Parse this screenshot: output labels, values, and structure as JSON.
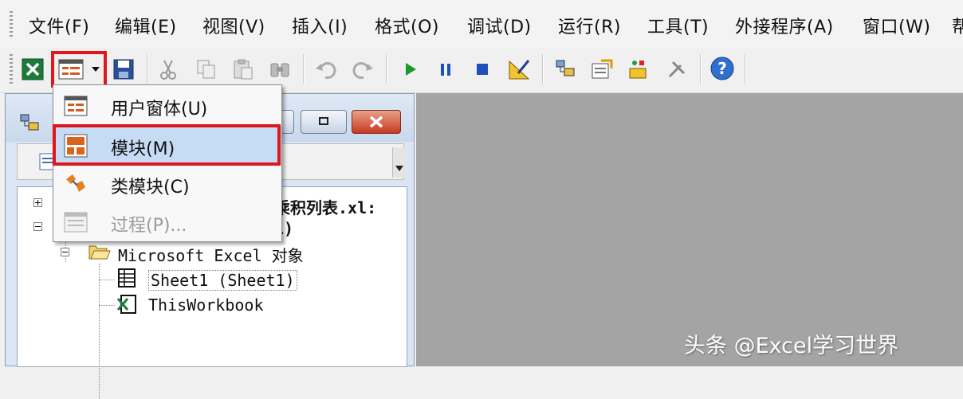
{
  "menu": [
    "文件(F)",
    "编辑(E)",
    "视图(V)",
    "插入(I)",
    "格式(O)",
    "调试(D)",
    "运行(R)",
    "工具(T)",
    "外接程序(A)",
    "窗口(W)",
    "帮"
  ],
  "dropdown": {
    "items": [
      {
        "label": "用户窗体(U)",
        "icon": "userform-icon",
        "enabled": true
      },
      {
        "label": "模块(M)",
        "icon": "module-icon",
        "enabled": true,
        "highlighted": true
      },
      {
        "label": "类模块(C)",
        "icon": "class-module-icon",
        "enabled": true
      },
      {
        "label": "过程(P)...",
        "icon": "procedure-icon",
        "enabled": false
      }
    ]
  },
  "project": {
    "root_label_partial": "乘积列表.xl:",
    "child_partial": "1)",
    "folder": "Microsoft Excel 对象",
    "items": [
      "Sheet1 (Sheet1)",
      "ThisWorkbook"
    ]
  },
  "watermark": "头条 @Excel学习世界",
  "colors": {
    "highlight_box": "#e0161e",
    "menu_highlight": "#c6dcf5",
    "workspace": "#a4a4a4"
  }
}
